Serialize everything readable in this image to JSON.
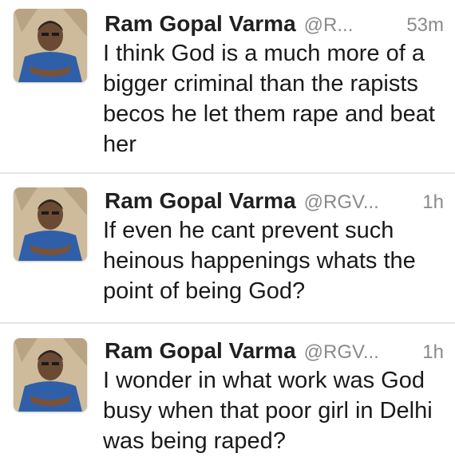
{
  "tweets": [
    {
      "name": "Ram Gopal Varma",
      "handle": "@R...",
      "time": "53m",
      "text": "I think God is a much more of a bigger criminal than the rapists becos he let them rape and beat her"
    },
    {
      "name": "Ram Gopal Varma",
      "handle": "@RGV...",
      "time": "1h",
      "text": "If even he cant prevent such heinous happenings whats the point of being God?"
    },
    {
      "name": "Ram Gopal Varma",
      "handle": "@RGV...",
      "time": "1h",
      "text": "I wonder in what work was God busy when that poor girl in Delhi was being raped?"
    }
  ],
  "colors": {
    "name": "#202020",
    "secondary": "#8a8a8a",
    "divider": "#e6e6e6"
  }
}
